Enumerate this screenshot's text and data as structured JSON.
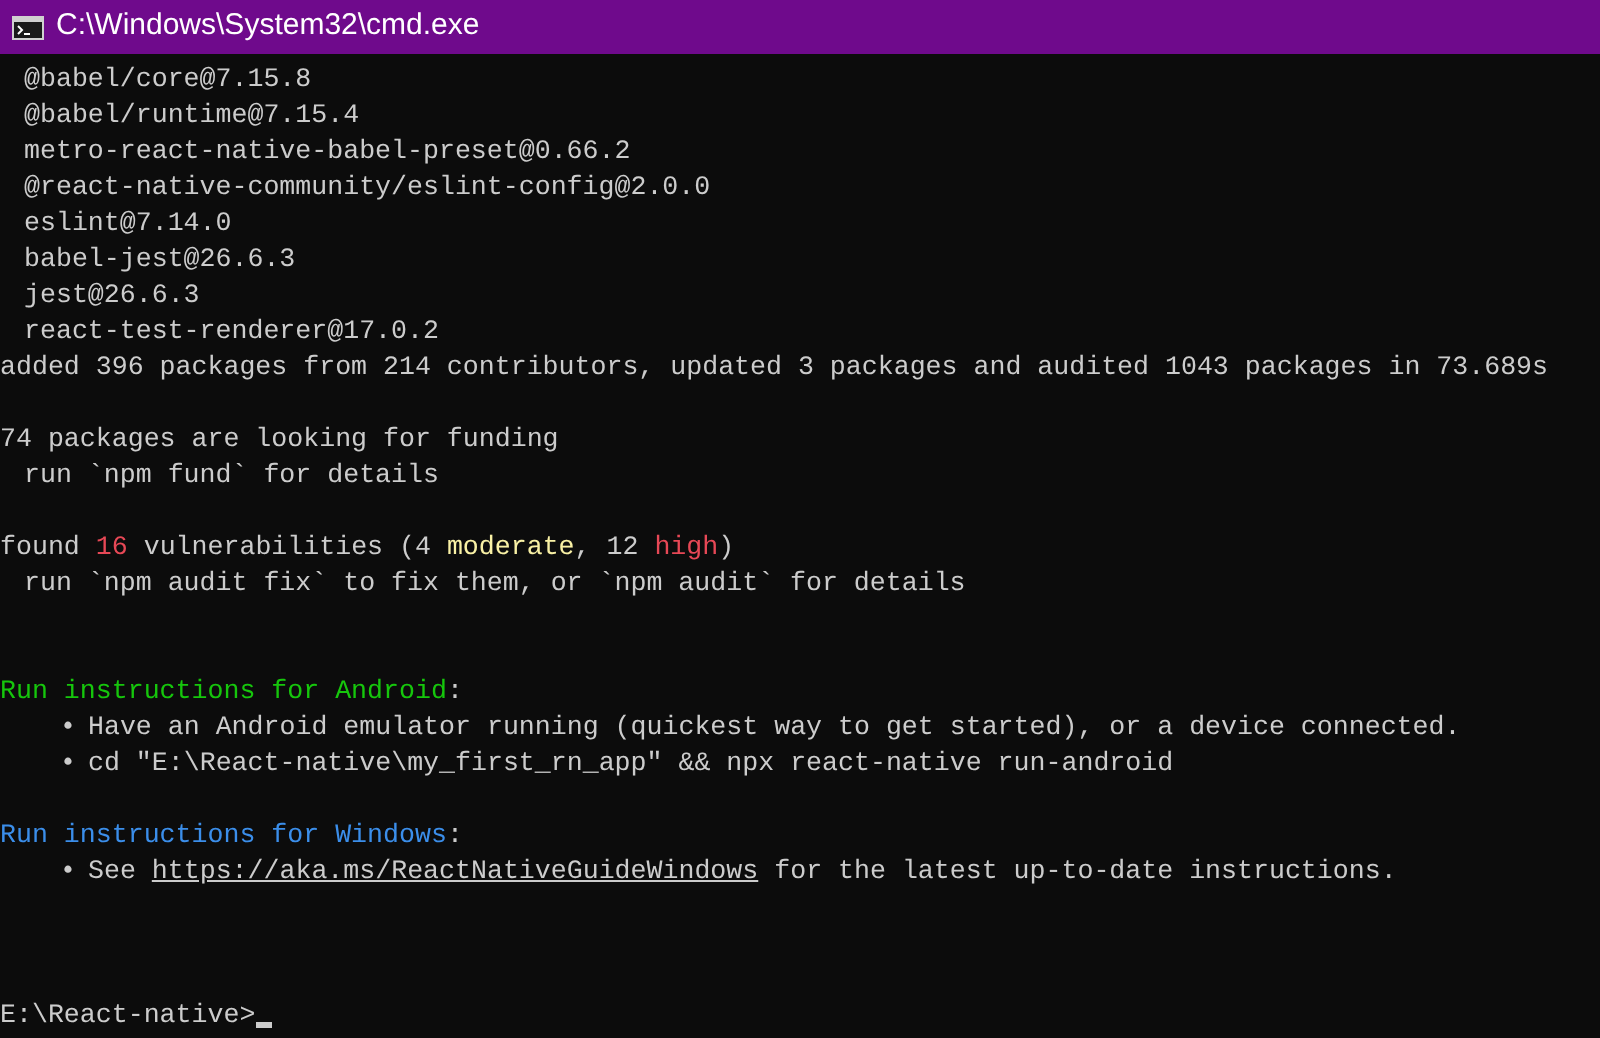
{
  "window": {
    "title": "C:\\Windows\\System32\\cmd.exe"
  },
  "lines": [
    {
      "kind": "package",
      "segments": [
        {
          "kind": "plain",
          "text": "@babel/core@7.15.8"
        }
      ]
    },
    {
      "kind": "package",
      "segments": [
        {
          "kind": "plain",
          "text": "@babel/runtime@7.15.4"
        }
      ]
    },
    {
      "kind": "package",
      "segments": [
        {
          "kind": "plain",
          "text": "metro-react-native-babel-preset@0.66.2"
        }
      ]
    },
    {
      "kind": "package",
      "segments": [
        {
          "kind": "plain",
          "text": "@react-native-community/eslint-config@2.0.0"
        }
      ]
    },
    {
      "kind": "package",
      "segments": [
        {
          "kind": "plain",
          "text": "eslint@7.14.0"
        }
      ]
    },
    {
      "kind": "package",
      "segments": [
        {
          "kind": "plain",
          "text": "babel-jest@26.6.3"
        }
      ]
    },
    {
      "kind": "package",
      "segments": [
        {
          "kind": "plain",
          "text": "jest@26.6.3"
        }
      ]
    },
    {
      "kind": "package",
      "segments": [
        {
          "kind": "plain",
          "text": "react-test-renderer@17.0.2"
        }
      ]
    },
    {
      "kind": "plain",
      "segments": [
        {
          "kind": "plain",
          "text": "added 396 packages from 214 contributors, updated 3 packages and audited 1043 packages in 73.689s"
        }
      ]
    },
    {
      "kind": "blank"
    },
    {
      "kind": "plain",
      "segments": [
        {
          "kind": "plain",
          "text": "74 packages are looking for funding"
        }
      ]
    },
    {
      "kind": "indent",
      "segments": [
        {
          "kind": "plain",
          "text": "run `npm fund` for details"
        }
      ]
    },
    {
      "kind": "blank"
    },
    {
      "kind": "plain",
      "segments": [
        {
          "kind": "plain",
          "text": "found "
        },
        {
          "kind": "danger",
          "text": "16"
        },
        {
          "kind": "plain",
          "text": " vulnerabilities (4 "
        },
        {
          "kind": "warning",
          "text": "moderate"
        },
        {
          "kind": "plain",
          "text": ", 12 "
        },
        {
          "kind": "danger",
          "text": "high"
        },
        {
          "kind": "plain",
          "text": ")"
        }
      ]
    },
    {
      "kind": "indent",
      "segments": [
        {
          "kind": "plain",
          "text": "run `npm audit fix` to fix them, or `npm audit` for details"
        }
      ]
    },
    {
      "kind": "blank"
    },
    {
      "kind": "blank"
    },
    {
      "kind": "plain",
      "segments": [
        {
          "kind": "success",
          "text": "Run instructions for Android"
        },
        {
          "kind": "plain",
          "text": ":"
        }
      ]
    },
    {
      "kind": "bullet",
      "bullet": "•",
      "segments": [
        {
          "kind": "plain",
          "text": "Have an Android emulator running (quickest way to get started), or a device connected."
        }
      ]
    },
    {
      "kind": "bullet",
      "bullet": "•",
      "segments": [
        {
          "kind": "plain",
          "text": "cd \"E:\\React-native\\my_first_rn_app\" && npx react-native run-android"
        }
      ]
    },
    {
      "kind": "blank"
    },
    {
      "kind": "plain",
      "segments": [
        {
          "kind": "info",
          "text": "Run instructions for Windows"
        },
        {
          "kind": "plain",
          "text": ":"
        }
      ]
    },
    {
      "kind": "bullet",
      "bullet": "•",
      "segments": [
        {
          "kind": "plain",
          "text": "See "
        },
        {
          "kind": "link",
          "text": "https://aka.ms/ReactNativeGuideWindows"
        },
        {
          "kind": "plain",
          "text": " for the latest up-to-date instructions."
        }
      ]
    },
    {
      "kind": "blank"
    },
    {
      "kind": "blank"
    },
    {
      "kind": "blank"
    },
    {
      "kind": "prompt",
      "segments": [
        {
          "kind": "plain",
          "text": "E:\\React-native>"
        }
      ]
    }
  ]
}
